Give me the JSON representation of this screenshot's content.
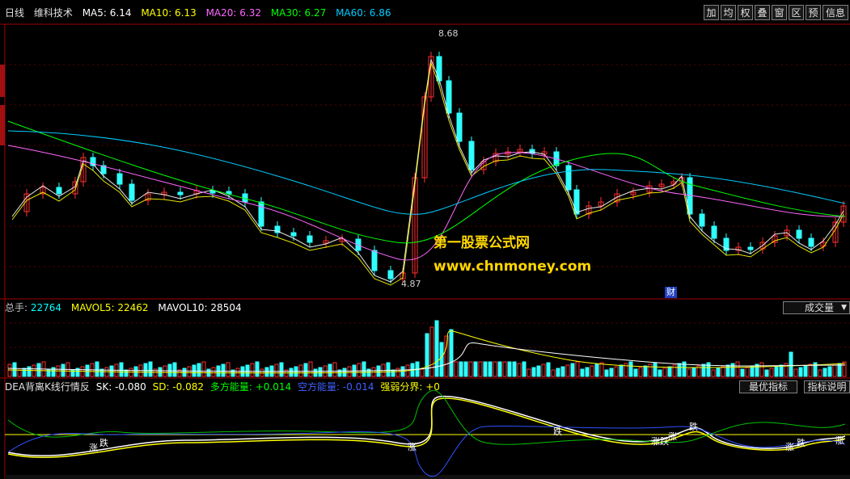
{
  "toolbar": [
    "加",
    "均",
    "权",
    "叠",
    "窗",
    "区",
    "预",
    "信息"
  ],
  "kline": {
    "period": "日线",
    "stock": "维科技术",
    "ma": [
      {
        "label": "MA5:",
        "value": "6.14",
        "color": "#ffffff"
      },
      {
        "label": "MA10:",
        "value": "6.13",
        "color": "#ffff00"
      },
      {
        "label": "MA20:",
        "value": "6.32",
        "color": "#ff66ff"
      },
      {
        "label": "MA30:",
        "value": "6.27",
        "color": "#00ff00"
      },
      {
        "label": "MA60:",
        "value": "6.86",
        "color": "#00ccff"
      }
    ],
    "high_label": "8.68",
    "low_label": "4.87",
    "badge": "财"
  },
  "volume": {
    "items": [
      {
        "label": "总手:",
        "value": "22764",
        "color": "#00ffff"
      },
      {
        "label": "MAVOL5:",
        "value": "22462",
        "color": "#ffff00"
      },
      {
        "label": "MAVOL10:",
        "value": "28504",
        "color": "#ffffff"
      }
    ],
    "dropdown": "成交量"
  },
  "indicator": {
    "name": "DEA背离K线行情反",
    "items": [
      {
        "label": "SK:",
        "value": "-0.080",
        "color": "#ffffff"
      },
      {
        "label": "SD:",
        "value": "-0.082",
        "color": "#ffff00"
      },
      {
        "label": "多方能量:",
        "value": "+0.014",
        "color": "#00ff00"
      },
      {
        "label": "空方能量:",
        "value": "-0.014",
        "color": "#4060ff"
      },
      {
        "label": "强弱分界:",
        "value": "+0",
        "color": "#ffff00"
      }
    ],
    "btn_best": "最优指标",
    "btn_help": "指标说明",
    "zhang": "涨",
    "die": "跌"
  },
  "watermark": {
    "line1": "第一股票公式网",
    "line2": "www.chnmoney.com"
  }
}
